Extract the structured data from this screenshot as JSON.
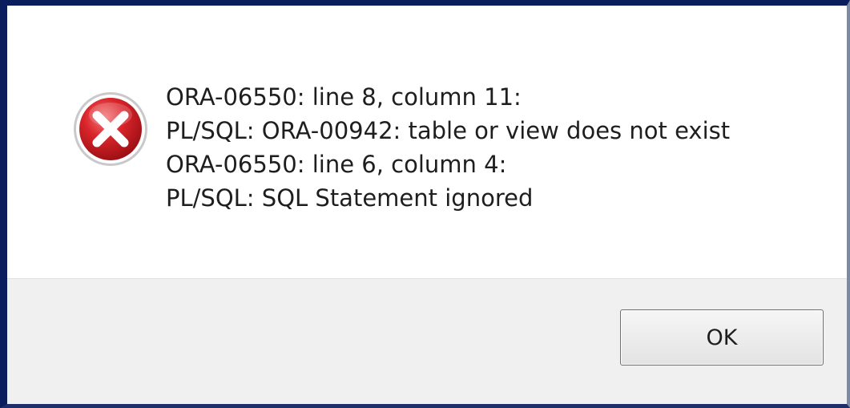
{
  "dialog": {
    "icon": "error-icon",
    "messages": [
      "ORA-06550: line 8, column 11:",
      "PL/SQL: ORA-00942: table or view does not exist",
      "ORA-06550: line 6, column 4:",
      "PL/SQL: SQL Statement ignored"
    ],
    "ok_label": "OK"
  },
  "colors": {
    "frame_border": "#0a1d5c",
    "icon_red": "#c8161d",
    "footer_background": "#f0f0f0"
  }
}
